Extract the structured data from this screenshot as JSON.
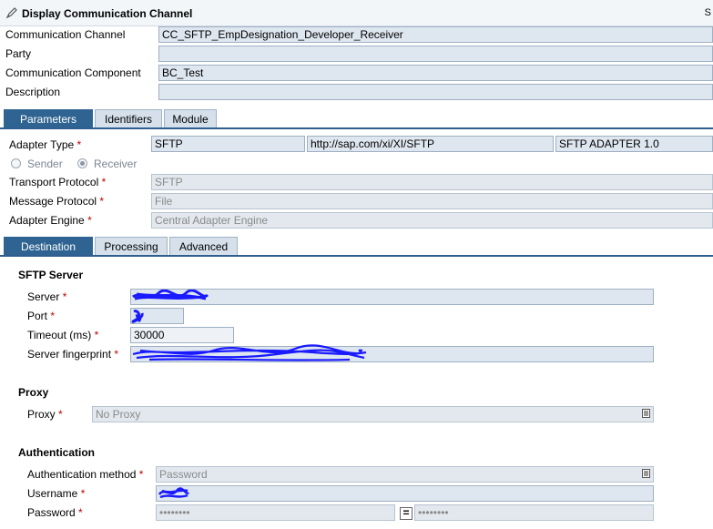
{
  "window": {
    "title": "Display Communication Channel",
    "corner_letter": "S"
  },
  "header": {
    "channel_label": "Communication Channel",
    "channel_value": "CC_SFTP_EmpDesignation_Developer_Receiver",
    "party_label": "Party",
    "party_value": "",
    "component_label": "Communication Component",
    "component_value": "BC_Test",
    "description_label": "Description",
    "description_value": ""
  },
  "main_tabs": [
    {
      "label": "Parameters",
      "active": true
    },
    {
      "label": "Identifiers",
      "active": false
    },
    {
      "label": "Module",
      "active": false
    }
  ],
  "params": {
    "adapter_type_label": "Adapter Type",
    "adapter_type": "SFTP",
    "adapter_namespace": "http://sap.com/xi/XI/SFTP",
    "adapter_version": "SFTP ADAPTER 1.0",
    "sender_label": "Sender",
    "receiver_label": "Receiver",
    "transport_label": "Transport Protocol",
    "transport_value": "SFTP",
    "message_label": "Message Protocol",
    "message_value": "File",
    "engine_label": "Adapter Engine",
    "engine_value": "Central Adapter Engine"
  },
  "sub_tabs": [
    {
      "label": "Destination",
      "active": true
    },
    {
      "label": "Processing",
      "active": false
    },
    {
      "label": "Advanced",
      "active": false
    }
  ],
  "sftp": {
    "heading": "SFTP Server",
    "server_label": "Server",
    "port_label": "Port",
    "timeout_label": "Timeout (ms)",
    "timeout_value": "30000",
    "fingerprint_label": "Server fingerprint"
  },
  "proxy": {
    "heading": "Proxy",
    "proxy_label": "Proxy",
    "proxy_value": "No Proxy"
  },
  "auth": {
    "heading": "Authentication",
    "method_label": "Authentication method",
    "method_value": "Password",
    "username_label": "Username",
    "password_label": "Password",
    "password_mask": "••••••••",
    "password_confirm_mask": "••••••••",
    "equals_sign": "="
  },
  "required_marker": "*",
  "colors": {
    "tab_active": "#2f6492",
    "field_bg": "#dde6ef",
    "required": "#c00000",
    "redaction": "#1a1aff"
  },
  "icons": {
    "title": "edit-channel-icon",
    "dropdown": "dropdown-icon"
  }
}
